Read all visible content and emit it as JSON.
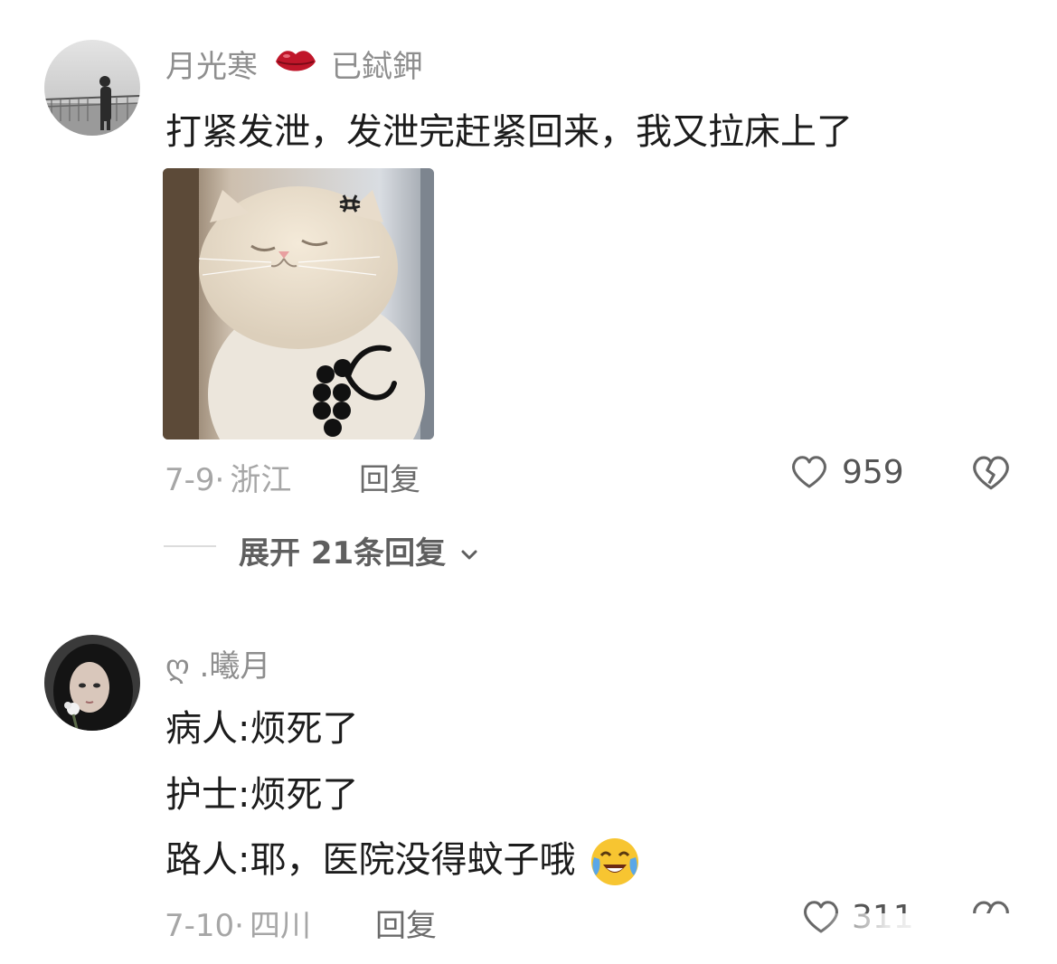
{
  "comments": [
    {
      "username": "月光寒",
      "badge_icon": "lips-icon",
      "badge_text": "已鋱鉀",
      "lines": [
        "打紧发泄，发泄完赶紧回来，我又拉床上了"
      ],
      "date": "7-9",
      "location": "浙江",
      "reply_label": "回复",
      "likes": "959",
      "expand_label": "展开 21条回复"
    },
    {
      "username_prefix": "ღ",
      "username": ".曦月",
      "lines": [
        "病人:烦死了",
        "护士:烦死了",
        "路人:耶，医院没得蚊子哦"
      ],
      "emoji": "crying-laughing-emoji",
      "date": "7-10",
      "location": "四川",
      "reply_label": "回复",
      "likes": "311"
    }
  ],
  "colors": {
    "username": "#8e8e8e",
    "meta": "#a6a6a6",
    "badge": "#c0162a",
    "emoji": "#f7c531"
  }
}
